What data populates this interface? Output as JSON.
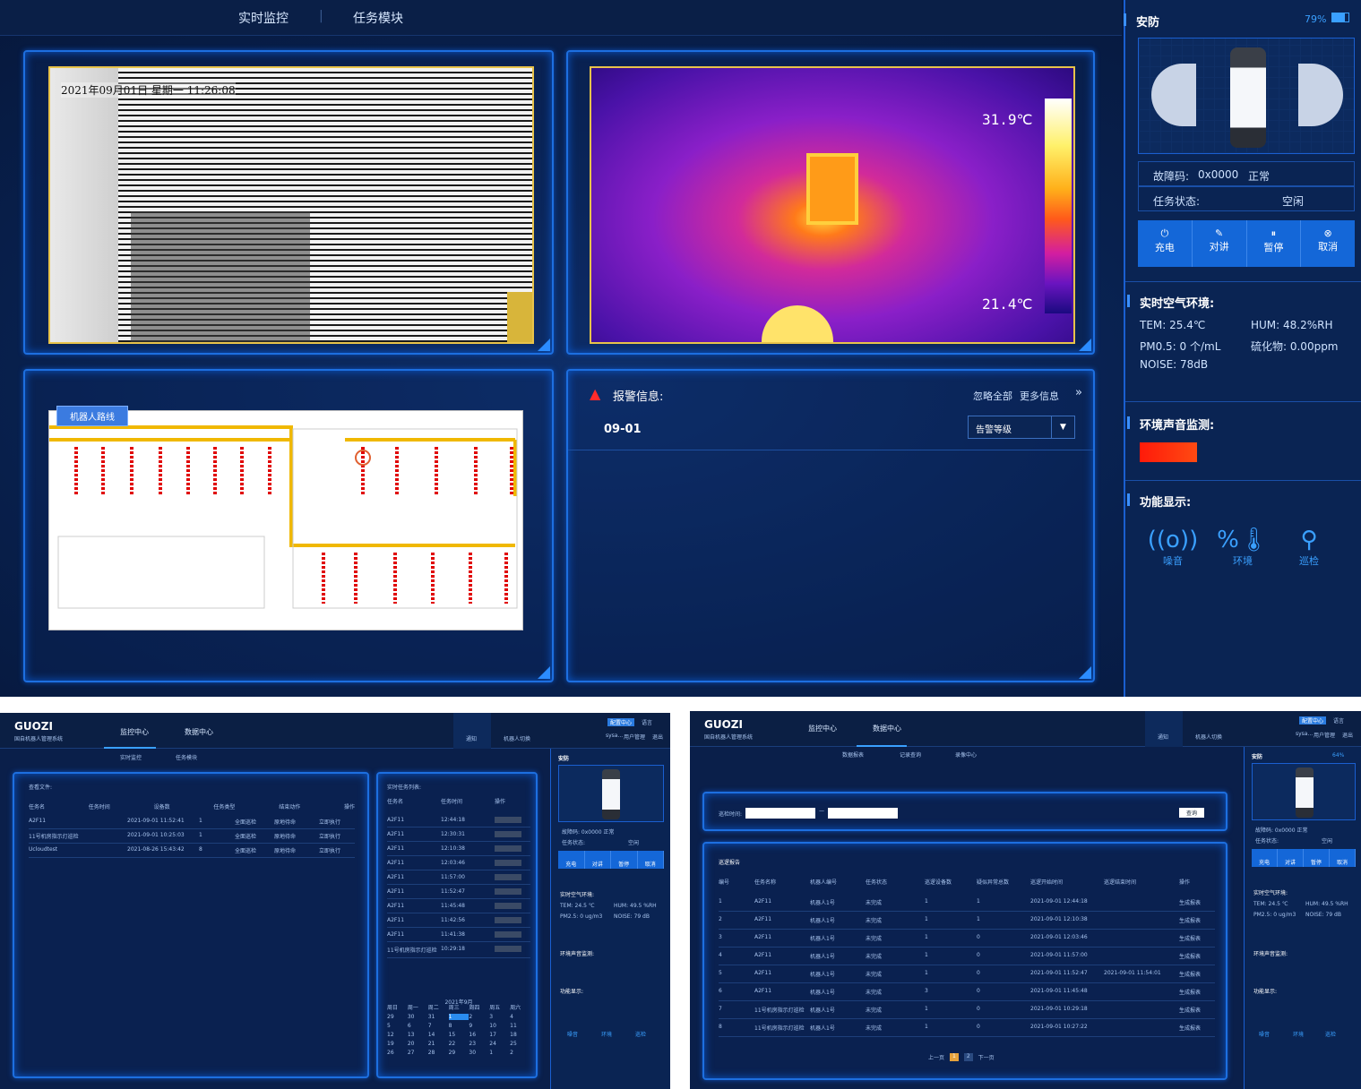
{
  "top": {
    "nav": {
      "tab1": "实时监控",
      "tab2": "任务模块"
    },
    "camera": {
      "timestamp": "2021年09月01日 星期一 11:26:08"
    },
    "thermal": {
      "max_temp": "31.9℃",
      "min_temp": "21.4℃"
    },
    "map": {
      "route_button": "机器人路线"
    },
    "alarm": {
      "title": "报警信息:",
      "ignore_all": "忽略全部",
      "more_info": "更多信息",
      "date": "09-01",
      "level_select": "告警等级"
    },
    "sidebar": {
      "title": "安防",
      "battery": "79%",
      "fault_label": "故障码:",
      "fault_code": "0x0000",
      "fault_status": "正常",
      "task_label": "任务状态:",
      "task_status": "空闲",
      "buttons": [
        "充电",
        "对讲",
        "暂停",
        "取消"
      ],
      "air_title": "实时空气环境:",
      "tem": "TEM: 25.4℃",
      "hum": "HUM: 48.2%RH",
      "pm": "PM0.5: 0 个/mL",
      "h2s": "硫化物: 0.00ppm",
      "noise": "NOISE: 78dB",
      "sound_title": "环境声音监测:",
      "func_title": "功能显示:",
      "functions": [
        "噪音",
        "环境",
        "巡检"
      ],
      "sound_level_color": "#ff3a12"
    }
  },
  "left_shot": {
    "logo": "GUOZI",
    "subtitle": "国自机器人管理系统",
    "nav": [
      "监控中心",
      "数据中心"
    ],
    "header_right": [
      "通知",
      "机器人切换",
      "配置中心",
      "语言",
      "sysa...",
      "用户管理",
      "退出"
    ],
    "subnav": [
      "实时监控",
      "任务模块"
    ],
    "files_title": "查看文件:",
    "file_columns": [
      "任务名",
      "任务时间",
      "设备数",
      "任务类型",
      "结束动作",
      "操作"
    ],
    "file_rows": [
      [
        "A2F11",
        "2021-09-01 11:52:41",
        "1",
        "全面巡检",
        "原地待命",
        "立即执行"
      ],
      [
        "11号机房指示灯巡检",
        "2021-09-01 10:25:03",
        "1",
        "全面巡检",
        "原地待命",
        "立即执行"
      ],
      [
        "Ucloudtest",
        "2021-08-26 15:43:42",
        "8",
        "全面巡检",
        "原地待命",
        "立即执行"
      ]
    ],
    "task_list_title": "实时任务列表:",
    "task_columns": [
      "任务名",
      "任务时间",
      "操作"
    ],
    "task_rows": [
      [
        "A2F11",
        "12:44:18"
      ],
      [
        "A2F11",
        "12:30:31"
      ],
      [
        "A2F11",
        "12:10:38"
      ],
      [
        "A2F11",
        "12:03:46"
      ],
      [
        "A2F11",
        "11:57:00"
      ],
      [
        "A2F11",
        "11:52:47"
      ],
      [
        "A2F11",
        "11:45:48"
      ],
      [
        "A2F11",
        "11:42:56"
      ],
      [
        "A2F11",
        "11:41:38"
      ],
      [
        "11号机房指示灯巡检",
        "10:29:18"
      ]
    ],
    "calendar_title": "2021年9月",
    "weekdays": [
      "周日",
      "周一",
      "周二",
      "周三",
      "周四",
      "周五",
      "周六"
    ],
    "calendar_days": [
      "29",
      "30",
      "31",
      "1",
      "2",
      "3",
      "4",
      "5",
      "6",
      "7",
      "8",
      "9",
      "10",
      "11",
      "12",
      "13",
      "14",
      "15",
      "16",
      "17",
      "18",
      "19",
      "20",
      "21",
      "22",
      "23",
      "24",
      "25",
      "26",
      "27",
      "28",
      "29",
      "30",
      "1",
      "2"
    ],
    "sidebar": {
      "title": "安防",
      "fault": "故障码:  0x0000    正常",
      "task": "任务状态:",
      "task_status": "空闲",
      "buttons": [
        "充电",
        "对讲",
        "暂停",
        "取消"
      ],
      "air_title": "实时空气环境:",
      "tem": "TEM: 24.5 ℃",
      "hum": "HUM: 49.5 %RH",
      "pm": "PM2.5: 0 ug/m3",
      "noise": "NOISE: 79 dB",
      "sound_title": "环境声音监测:",
      "func_title": "功能显示:",
      "functions": [
        "噪音",
        "环境",
        "巡检"
      ]
    }
  },
  "right_shot": {
    "logo": "GUOZI",
    "subtitle": "国自机器人管理系统",
    "nav": [
      "监控中心",
      "数据中心"
    ],
    "header_right": [
      "通知",
      "机器人切换",
      "配置中心",
      "语言",
      "sysa...",
      "用户管理",
      "退出"
    ],
    "subnav": [
      "数据报表",
      "记录查询",
      "录像中心"
    ],
    "filter_label": "巡检时间:",
    "query_button": "查询",
    "report_title": "巡逻报告",
    "columns": [
      "编号",
      "任务名称",
      "机器人编号",
      "任务状态",
      "巡逻设备数",
      "疑似异常总数",
      "巡逻开始时间",
      "巡逻结束时间",
      "操作"
    ],
    "rows": [
      [
        "1",
        "A2F11",
        "机器人1号",
        "未完成",
        "1",
        "1",
        "2021-09-01 12:44:18",
        "",
        "生成报表"
      ],
      [
        "2",
        "A2F11",
        "机器人1号",
        "未完成",
        "1",
        "1",
        "2021-09-01 12:10:38",
        "",
        "生成报表"
      ],
      [
        "3",
        "A2F11",
        "机器人1号",
        "未完成",
        "1",
        "0",
        "2021-09-01 12:03:46",
        "",
        "生成报表"
      ],
      [
        "4",
        "A2F11",
        "机器人1号",
        "未完成",
        "1",
        "0",
        "2021-09-01 11:57:00",
        "",
        "生成报表"
      ],
      [
        "5",
        "A2F11",
        "机器人1号",
        "未完成",
        "1",
        "0",
        "2021-09-01 11:52:47",
        "2021-09-01 11:54:01",
        "生成报表"
      ],
      [
        "6",
        "A2F11",
        "机器人1号",
        "未完成",
        "3",
        "0",
        "2021-09-01 11:45:48",
        "",
        "生成报表"
      ],
      [
        "7",
        "11号机房指示灯巡检",
        "机器人1号",
        "未完成",
        "1",
        "0",
        "2021-09-01 10:29:18",
        "",
        "生成报表"
      ],
      [
        "8",
        "11号机房指示灯巡检",
        "机器人1号",
        "未完成",
        "1",
        "0",
        "2021-09-01 10:27:22",
        "",
        "生成报表"
      ]
    ],
    "pagination": [
      "上一页",
      "1",
      "2",
      "下一页"
    ],
    "sidebar": {
      "title": "安防",
      "battery": "64%",
      "fault": "故障码:  0x0000    正常",
      "task": "任务状态:",
      "task_status": "空闲",
      "buttons": [
        "充电",
        "对讲",
        "暂停",
        "取消"
      ],
      "air_title": "实时空气环境:",
      "tem": "TEM: 24.5 ℃",
      "hum": "HUM: 49.5 %RH",
      "pm": "PM2.5: 0 ug/m3",
      "noise": "NOISE: 79 dB",
      "sound_title": "环境声音监测:",
      "func_title": "功能显示:",
      "functions": [
        "噪音",
        "环境",
        "巡检"
      ]
    }
  }
}
